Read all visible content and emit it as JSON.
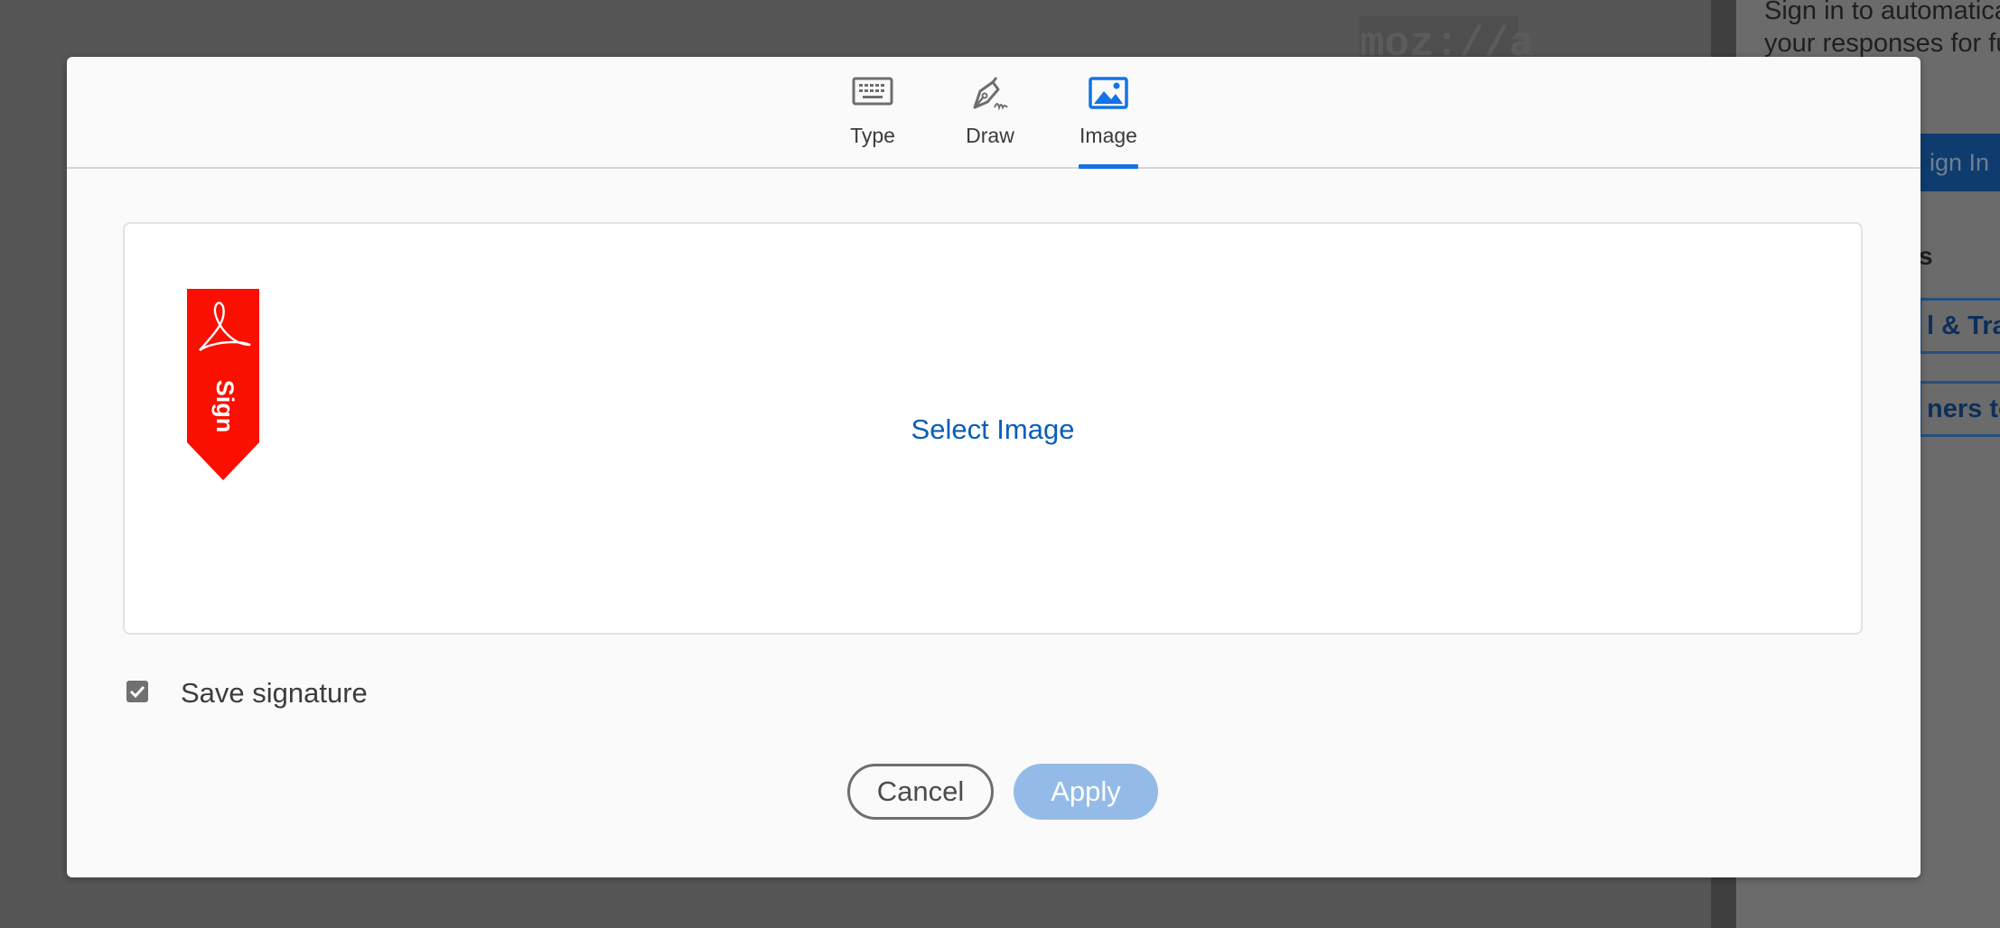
{
  "background": {
    "logo": "moz://a",
    "signin_text_line1": "Sign in to automatica",
    "signin_text_line2": "your responses for fu",
    "signin_button": "ign In",
    "heading_partial": "s",
    "box1_partial": "l & Trac",
    "box2_partial": "ners to"
  },
  "modal": {
    "tabs": [
      {
        "label": "Type",
        "icon": "keyboard-icon",
        "active": false
      },
      {
        "label": "Draw",
        "icon": "pen-icon",
        "active": false
      },
      {
        "label": "Image",
        "icon": "image-icon",
        "active": true
      }
    ],
    "badge_text": "Sign",
    "select_image": "Select Image",
    "save_signature": {
      "label": "Save signature",
      "checked": true
    },
    "cancel_label": "Cancel",
    "apply_label": "Apply"
  },
  "colors": {
    "accent": "#1473e6",
    "link": "#0a5eb8",
    "badge_red": "#fa0f00",
    "apply_disabled": "#94bbe7"
  }
}
